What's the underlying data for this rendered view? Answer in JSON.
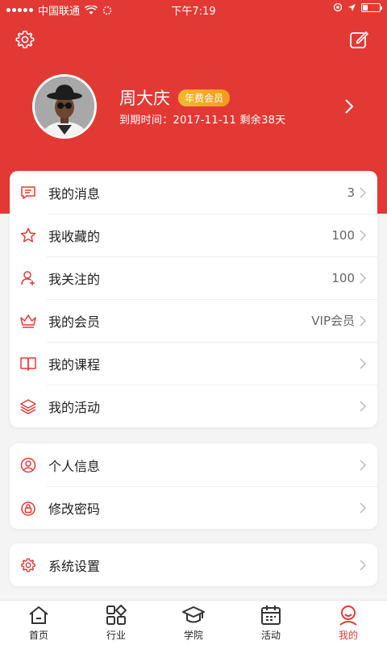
{
  "status_bar": {
    "carrier": "中国联通",
    "time": "下午7:19"
  },
  "header": {
    "settings_icon": "gear-icon",
    "edit_icon": "edit-icon"
  },
  "profile": {
    "name": "周大庆",
    "badge": "年费会员",
    "expire": "到期时间：2017-11-11 剩余38天"
  },
  "menu_main": [
    {
      "label": "我的消息",
      "value": "3",
      "icon": "message-icon"
    },
    {
      "label": "我收藏的",
      "value": "100",
      "icon": "star-icon"
    },
    {
      "label": "我关注的",
      "value": "100",
      "icon": "user-add-icon"
    },
    {
      "label": "我的会员",
      "value": "VIP会员",
      "icon": "crown-icon"
    },
    {
      "label": "我的课程",
      "value": "",
      "icon": "book-icon"
    },
    {
      "label": "我的活动",
      "value": "",
      "icon": "layers-icon"
    }
  ],
  "menu_account": [
    {
      "label": "个人信息",
      "icon": "user-circle-icon"
    },
    {
      "label": "修改密码",
      "icon": "lock-icon"
    }
  ],
  "menu_system": [
    {
      "label": "系统设置",
      "icon": "gear-icon"
    }
  ],
  "tabbar": {
    "items": [
      {
        "label": "首页",
        "icon": "home-icon"
      },
      {
        "label": "行业",
        "icon": "grid-icon"
      },
      {
        "label": "学院",
        "icon": "graduation-cap-icon"
      },
      {
        "label": "活动",
        "icon": "calendar-icon"
      },
      {
        "label": "我的",
        "icon": "profile-icon"
      }
    ],
    "active_index": 4
  },
  "colors": {
    "brand_red": "#e33935",
    "badge_orange": "#f39a1f"
  }
}
